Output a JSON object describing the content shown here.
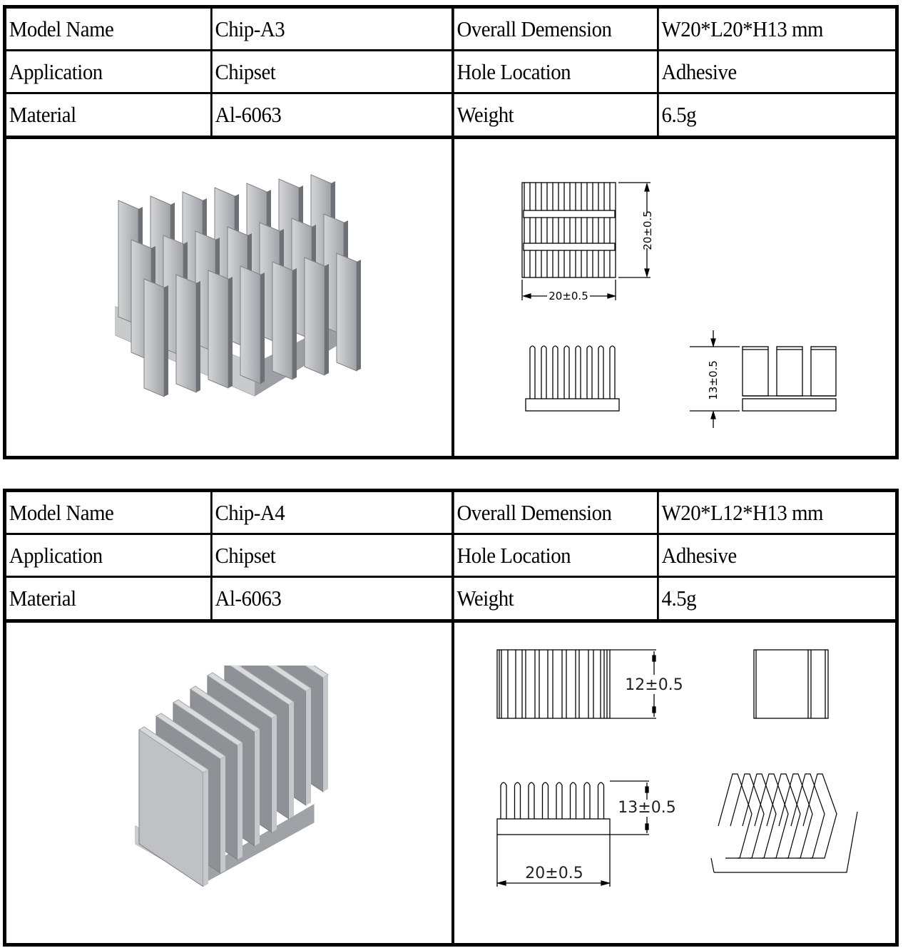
{
  "products": [
    {
      "model_label": "Model Name",
      "model_value": "Chip-A3",
      "dimension_label": "Overall Demension",
      "dimension_value": "W20*L20*H13 mm",
      "application_label": "Application",
      "application_value": "Chipset",
      "hole_label": "Hole Location",
      "hole_value": "Adhesive",
      "material_label": "Material",
      "material_value": "Al-6063",
      "weight_label": "Weight",
      "weight_value": "6.5g",
      "photo": "heatsink-photo-pin-fin",
      "drawing": {
        "top_width_dim": "20±0.5",
        "top_length_dim": "20±0.5",
        "height_dim": "13±0.5"
      }
    },
    {
      "model_label": "Model Name",
      "model_value": "Chip-A4",
      "dimension_label": "Overall Demension",
      "dimension_value": "W20*L12*H13 mm",
      "application_label": "Application",
      "application_value": "Chipset",
      "hole_label": "Hole Location",
      "hole_value": "Adhesive",
      "material_label": "Material",
      "material_value": "Al-6063",
      "weight_label": "Weight",
      "weight_value": "4.5g",
      "photo": "heatsink-photo-straight-fin",
      "drawing": {
        "length_dim": "12±0.5",
        "height_dim": "13±0.5",
        "width_dim": "20±0.5"
      }
    }
  ],
  "colors": {
    "border": "#000000",
    "metal_light": "#c9cacc",
    "metal_mid": "#a7a9ac",
    "metal_dark": "#6f7276"
  }
}
